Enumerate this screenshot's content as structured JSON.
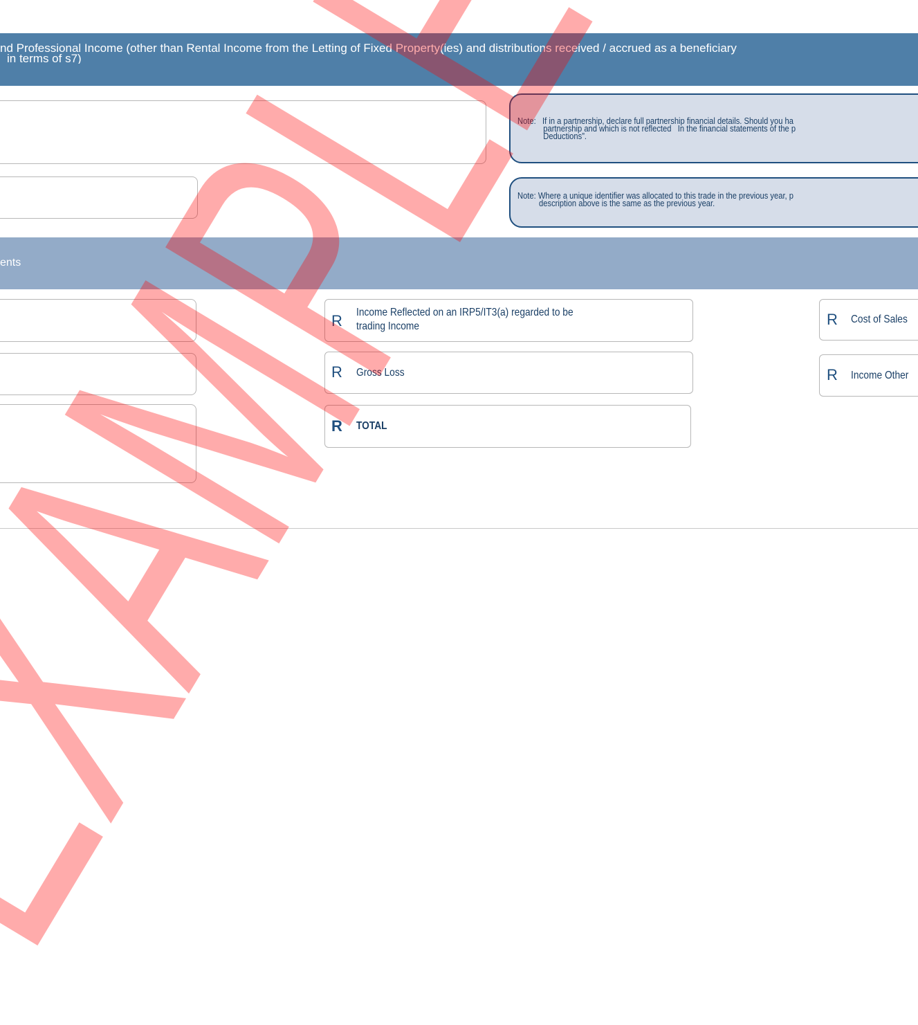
{
  "header": {
    "line1": "nd Professional Income (other than Rental Income from the Letting of Fixed Property(ies) and distributions received / accrued as a beneficiary",
    "line2": "in terms of s7)"
  },
  "notes": {
    "partnership": "Note:   If in a partnership, declare full partnership financial details. Should you ha\n            partnership and which is not reflected   In the financial statements of the p\n            Deductions”.",
    "identifier": "Note: Where a unique identifier was allocated to this trade in the previous year, p\n          description above is the same as the previous year."
  },
  "section": {
    "title": "ents"
  },
  "fields": {
    "currency_symbol": "R",
    "irp5_income_label": "Income Reflected on an IRP5/IT3(a) regarded to be\ntrading Income",
    "gross_loss_label": "Gross Loss",
    "total_label": "TOTAL",
    "cost_of_sales_label": "Cost of Sales",
    "income_other_label": "Income Other"
  },
  "watermark": {
    "text": "EXAMPLE",
    "color": "#ff0000"
  }
}
